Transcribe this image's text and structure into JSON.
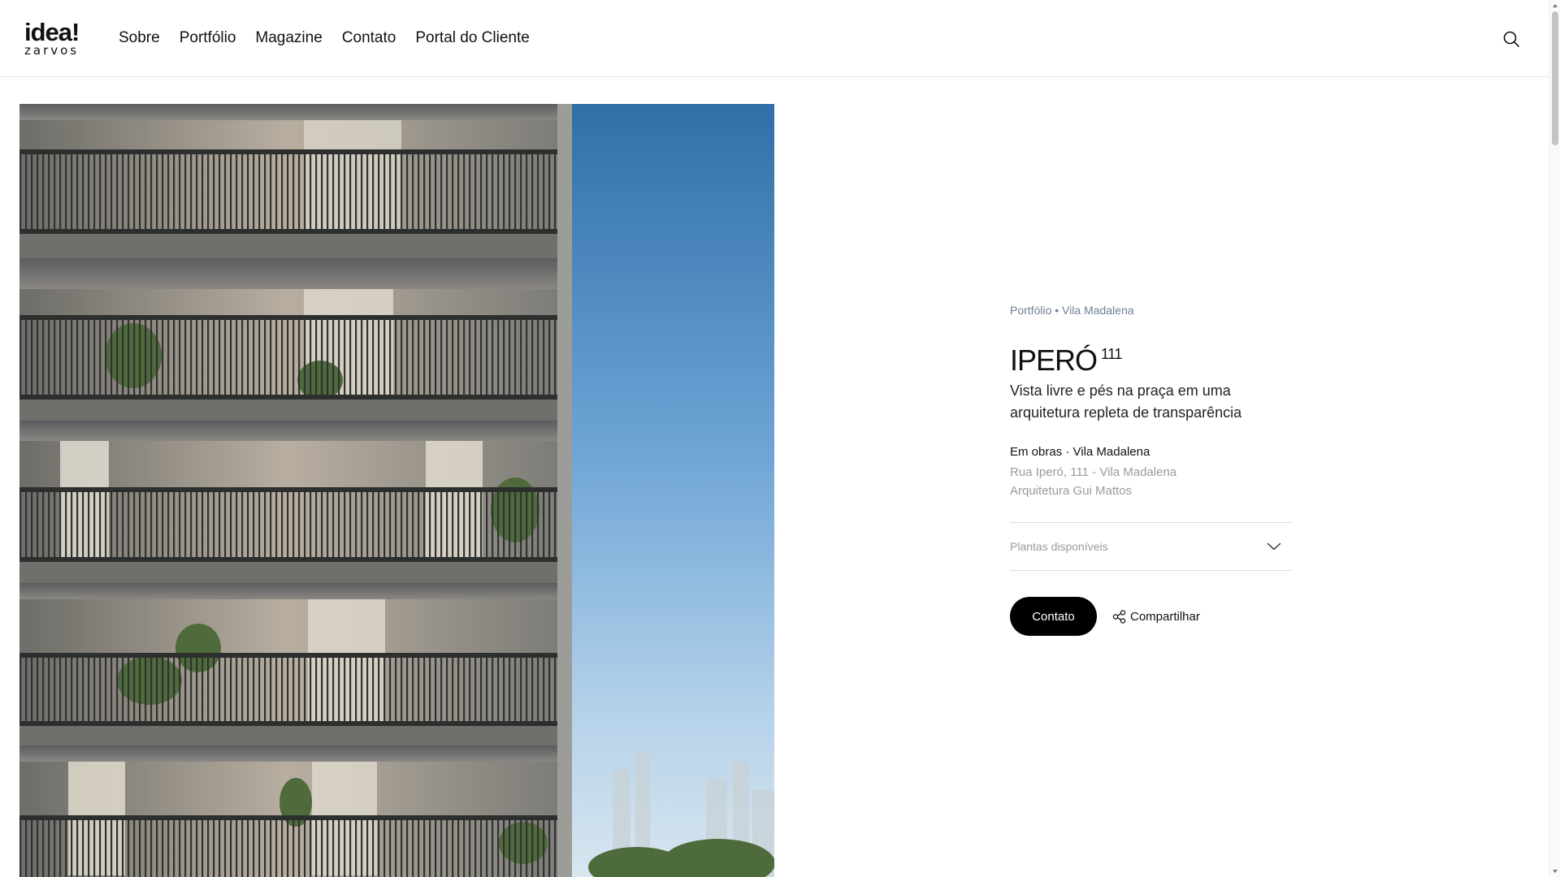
{
  "header": {
    "logo_top": "idea!",
    "logo_bottom": "zarvos",
    "nav": [
      "Sobre",
      "Portfólio",
      "Magazine",
      "Contato",
      "Portal do Cliente"
    ]
  },
  "project": {
    "breadcrumb_section": "Portfólio",
    "breadcrumb_separator": " • ",
    "breadcrumb_neighborhood": "Vila Madalena",
    "title": "IPERÓ",
    "title_number": "111",
    "subtitle": "Vista livre e pés na praça em uma arquitetura repleta de transparência",
    "status": "Em obras · Vila Madalena",
    "address": "Rua Iperó, 111 - Vila Madalena",
    "architect": "Arquitetura Gui Mattos",
    "plants_label": "Plantas disponíveis",
    "contact_label": "Contato",
    "share_label": "Compartilhar"
  },
  "icons": {
    "search": "search-icon",
    "chevron": "chevron-down-icon",
    "share": "share-icon"
  },
  "colors": {
    "accent": "#000000",
    "breadcrumb": "#6f7f95",
    "muted": "#9a9a9a"
  }
}
